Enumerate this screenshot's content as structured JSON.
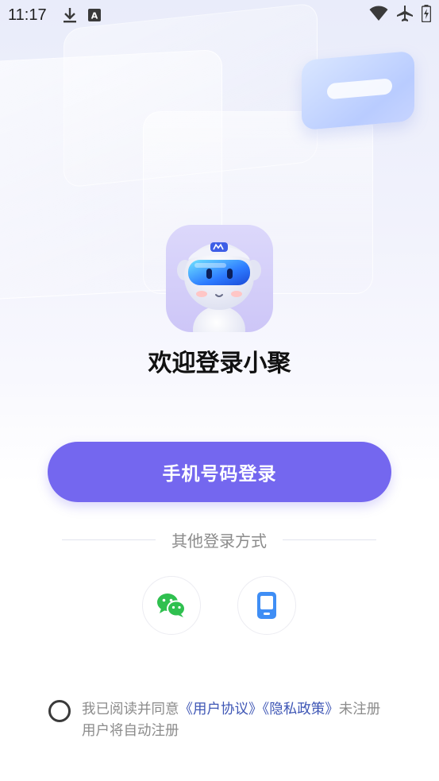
{
  "status_bar": {
    "time": "11:17",
    "left_icons": [
      "download-icon",
      "font-a-icon"
    ],
    "right_icons": [
      "wifi-icon",
      "airplane-mode-icon",
      "battery-charging-icon"
    ]
  },
  "logo": {
    "icon": "robot-mascot-icon"
  },
  "title": "欢迎登录小聚",
  "primary_button": {
    "label": "手机号码登录"
  },
  "other_login": {
    "label": "其他登录方式",
    "options": [
      {
        "icon": "wechat-icon",
        "color": "#2fc04f"
      },
      {
        "icon": "phone-device-icon",
        "color": "#3f8ef5"
      }
    ]
  },
  "agreement": {
    "prefix": "我已阅读并同意",
    "user_agreement": "《用户协议》",
    "privacy_policy": "《隐私政策》",
    "suffix": "未注册用户将自动注册"
  },
  "colors": {
    "accent": "#7467ef",
    "link": "#3e56b5",
    "muted_text": "#8b8b8b"
  }
}
